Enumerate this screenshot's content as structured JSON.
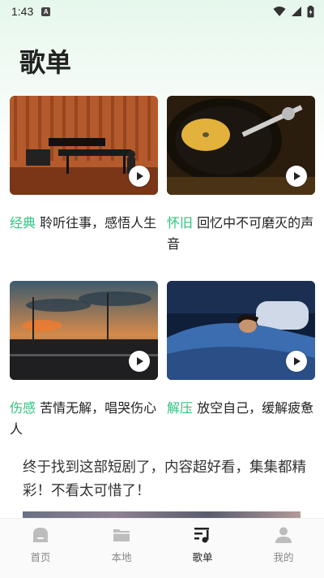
{
  "status_bar": {
    "time": "1:43",
    "notification_icon": "A"
  },
  "page": {
    "title": "歌单"
  },
  "playlists": [
    {
      "tag": "经典",
      "text": " 聆听往事，感悟人生",
      "thumb": "piano-concert-hall",
      "play_icon": "play-icon"
    },
    {
      "tag": "怀旧",
      "text": " 回忆中不可磨灭的声音",
      "thumb": "vinyl-turntable",
      "play_icon": "play-icon"
    },
    {
      "tag": "伤感",
      "text": " 苦情无解，唱哭伤心人",
      "thumb": "sunset-window",
      "play_icon": "play-icon"
    },
    {
      "tag": "解压",
      "text": " 放空自己，缓解疲惫",
      "thumb": "sleeping-woman",
      "play_icon": "play-icon"
    }
  ],
  "promo": {
    "text": "终于找到这部短剧了，内容超好看，集集都精彩！不看太可惜了！"
  },
  "tabbar": {
    "items": [
      {
        "label": "首页",
        "icon": "home-icon",
        "active": false
      },
      {
        "label": "本地",
        "icon": "folder-icon",
        "active": false
      },
      {
        "label": "歌单",
        "icon": "music-note-icon",
        "active": true
      },
      {
        "label": "我的",
        "icon": "person-icon",
        "active": false
      }
    ]
  },
  "colors": {
    "accent": "#2ec27e",
    "text": "#222222",
    "tab_inactive": "#888888"
  }
}
